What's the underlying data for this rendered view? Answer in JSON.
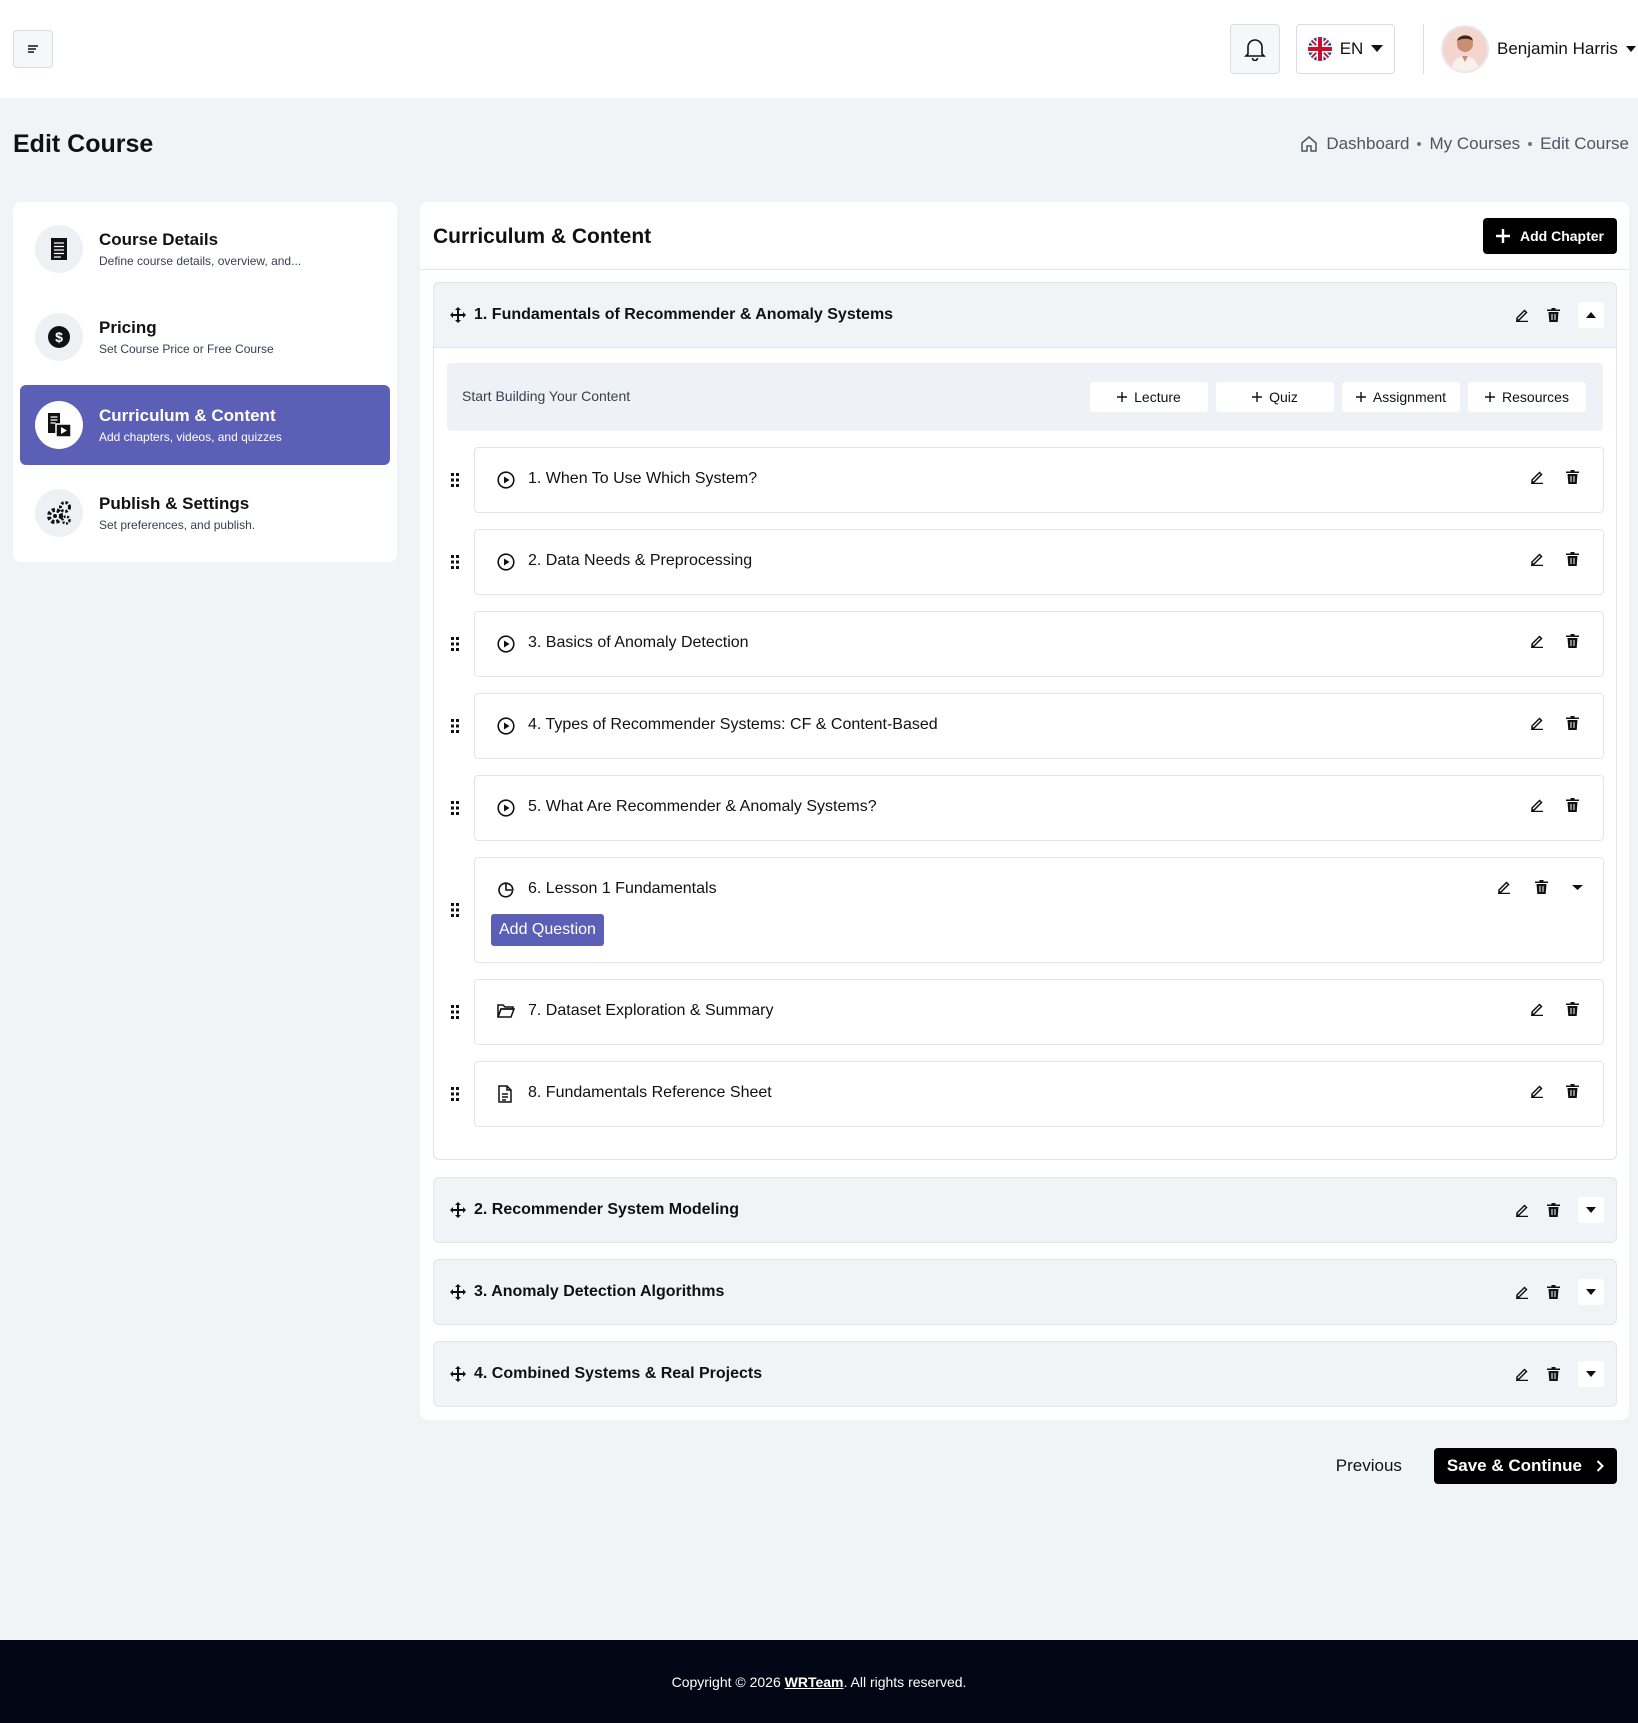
{
  "header": {
    "language": "EN",
    "user_name": "Benjamin Harris"
  },
  "page": {
    "title": "Edit Course",
    "breadcrumb": [
      "Dashboard",
      "My Courses",
      "Edit Course"
    ]
  },
  "steps": [
    {
      "title": "Course Details",
      "desc": "Define course details, overview, and...",
      "icon": "document-icon"
    },
    {
      "title": "Pricing",
      "desc": "Set Course Price or Free Course",
      "icon": "dollar-icon"
    },
    {
      "title": "Curriculum & Content",
      "desc": "Add chapters, videos, and quizzes",
      "icon": "curriculum-icon",
      "active": true
    },
    {
      "title": "Publish & Settings",
      "desc": "Set preferences, and publish.",
      "icon": "gears-icon"
    }
  ],
  "curriculum": {
    "title": "Curriculum & Content",
    "add_chapter_label": "Add Chapter",
    "builder_text": "Start Building Your Content",
    "builder_buttons": [
      "Lecture",
      "Quiz",
      "Assignment",
      "Resources"
    ],
    "add_question_label": "Add Question",
    "chapters": [
      {
        "name": "1. Fundamentals of Recommender & Anomaly Systems",
        "expanded": true
      },
      {
        "name": "2. Recommender System Modeling",
        "expanded": false
      },
      {
        "name": "3. Anomaly Detection Algorithms",
        "expanded": false
      },
      {
        "name": "4. Combined Systems & Real Projects",
        "expanded": false
      }
    ],
    "items": [
      {
        "label": "1.  When To Use Which System?",
        "type": "lecture"
      },
      {
        "label": "2.  Data Needs & Preprocessing",
        "type": "lecture"
      },
      {
        "label": "3.  Basics of Anomaly Detection",
        "type": "lecture"
      },
      {
        "label": "4.  Types of Recommender Systems: CF & Content-Based",
        "type": "lecture"
      },
      {
        "label": "5.  What Are Recommender & Anomaly Systems?",
        "type": "lecture"
      },
      {
        "label": "6.  Lesson 1 Fundamentals",
        "type": "quiz"
      },
      {
        "label": "7.  Dataset Exploration & Summary",
        "type": "assignment"
      },
      {
        "label": "8.  Fundamentals Reference Sheet",
        "type": "resource"
      }
    ]
  },
  "nav": {
    "previous_label": "Previous",
    "save_label": "Save & Continue"
  },
  "footer": {
    "prefix": "Copyright © 2026 ",
    "brand": "WRTeam",
    "suffix": ". All rights reserved."
  },
  "colors": {
    "accent": "#5b5fb6",
    "primary_button": "#000000",
    "background": "#f1f4f7",
    "footer": "#020514"
  }
}
